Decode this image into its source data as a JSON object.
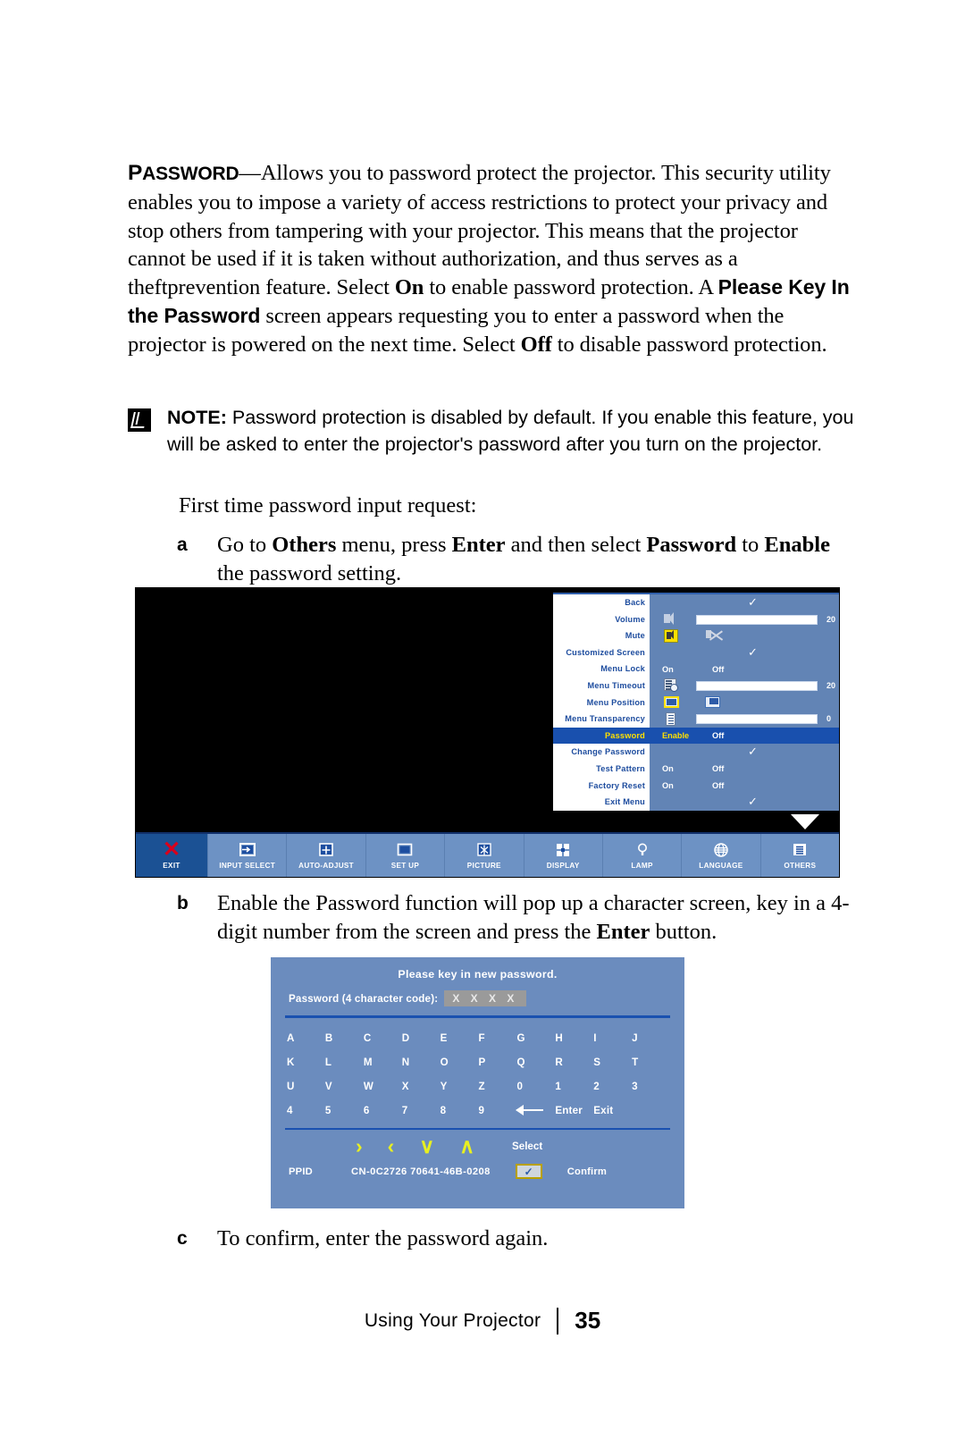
{
  "document": {
    "paragraph1": {
      "term": "Password",
      "term_cap": "P",
      "term_rest": "ASSWORD",
      "text_a": "—Allows you to password protect the projector. This security utility enables you to impose a variety of access restrictions to protect your privacy and stop others from tampering with your projector. This means that the projector cannot be used if it is taken without authorization, and thus serves as a theftprevention feature. Select ",
      "bold_on": "On",
      "text_b": " to enable password protection. A ",
      "bold_screen": "Please Key In the Password",
      "text_c": " screen appears requesting you to enter a password when the projector is powered on the next time. Select ",
      "bold_off": "Off",
      "text_d": " to disable password protection."
    },
    "note": {
      "label": "NOTE:",
      "text": " Password protection is disabled by default. If you enable this feature, you will be asked to enter the projector's password after you turn on the projector."
    },
    "first_time": "First time password input request:",
    "steps": [
      {
        "letter": "a",
        "text_a": "Go to ",
        "bold_1": "Others",
        "text_b": " menu, press ",
        "bold_2": "Enter",
        "text_c": " and then select ",
        "bold_3": "Password",
        "text_d": " to ",
        "bold_4": "Enable",
        "text_e": " the password setting."
      },
      {
        "letter": "b",
        "text_a": "Enable the Password function will pop up a character screen, key in a 4-digit number from the screen and press the ",
        "bold_1": "Enter",
        "text_b": " button."
      },
      {
        "letter": "c",
        "text_a": "To confirm, enter the password again."
      }
    ],
    "footer": {
      "text": "Using Your Projector",
      "page": "35"
    }
  },
  "osd_menu": {
    "rows": [
      {
        "label": "Back",
        "type": "check",
        "value": "✓"
      },
      {
        "label": "Volume",
        "type": "slider",
        "icon": "speaker-icon",
        "fill": 58,
        "value": "20"
      },
      {
        "label": "Mute",
        "type": "mute",
        "icon": "mute-icon"
      },
      {
        "label": "Customized Screen",
        "type": "check",
        "value": "✓"
      },
      {
        "label": "Menu Lock",
        "type": "onoff",
        "on": "On",
        "off": "Off"
      },
      {
        "label": "Menu Timeout",
        "type": "slider",
        "icon": "timeout-icon",
        "fill": 58,
        "value": "20"
      },
      {
        "label": "Menu Position",
        "type": "position",
        "icon": "position-icon"
      },
      {
        "label": "Menu Transparency",
        "type": "slider",
        "icon": "transparency-icon",
        "fill": 58,
        "value": "0"
      },
      {
        "label": "Password",
        "type": "onoff",
        "on": "Enable",
        "off": "Off",
        "selected": true
      },
      {
        "label": "Change Password",
        "type": "check",
        "value": "✓"
      },
      {
        "label": "Test Pattern",
        "type": "onoff",
        "on": "On",
        "off": "Off"
      },
      {
        "label": "Factory Reset",
        "type": "onoff",
        "on": "On",
        "off": "Off"
      },
      {
        "label": "Exit Menu",
        "type": "check",
        "value": "✓"
      }
    ],
    "toolbar": [
      {
        "label": "EXIT",
        "icon": "close-x-icon"
      },
      {
        "label": "INPUT SELECT",
        "icon": "input-select-icon"
      },
      {
        "label": "AUTO-ADJUST",
        "icon": "auto-adjust-icon"
      },
      {
        "label": "SET UP",
        "icon": "setup-icon"
      },
      {
        "label": "PICTURE",
        "icon": "picture-icon"
      },
      {
        "label": "DISPLAY",
        "icon": "display-icon"
      },
      {
        "label": "LAMP",
        "icon": "lamp-bulb-icon"
      },
      {
        "label": "LANGUAGE",
        "icon": "globe-icon"
      },
      {
        "label": "OTHERS",
        "icon": "others-list-icon"
      }
    ]
  },
  "password_screen": {
    "title": "Please key in new password.",
    "field_label": "Password (4 character code):",
    "field_value": "X X X X",
    "keys": [
      [
        "A",
        "B",
        "C",
        "D",
        "E",
        "F",
        "G",
        "H",
        "I",
        "J"
      ],
      [
        "K",
        "L",
        "M",
        "N",
        "O",
        "P",
        "Q",
        "R",
        "S",
        "T"
      ],
      [
        "U",
        "V",
        "W",
        "X",
        "Y",
        "Z",
        "0",
        "1",
        "2",
        "3"
      ],
      [
        "4",
        "5",
        "6",
        "7",
        "8",
        "9"
      ]
    ],
    "backspace": "←",
    "enter": "Enter",
    "exit": "Exit",
    "nav": {
      "right": "›",
      "left": "‹",
      "down": "∨",
      "up": "∧",
      "select": "Select"
    },
    "ppid_label": "PPID",
    "ppid_value": "CN-0C2726 70641-46B-0208",
    "confirm_mark": "✓",
    "confirm_label": "Confirm"
  }
}
